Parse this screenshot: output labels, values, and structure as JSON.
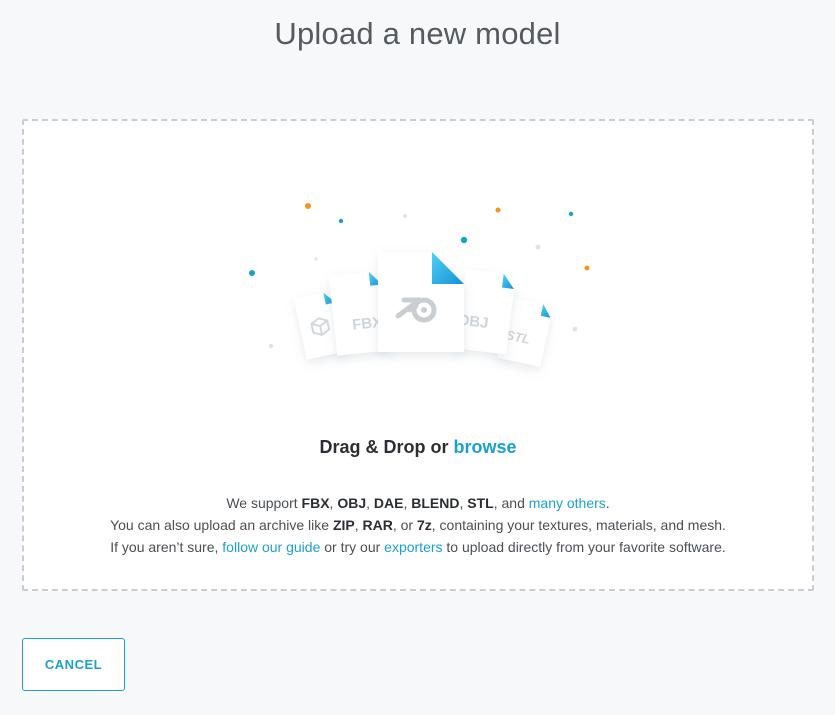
{
  "page": {
    "title": "Upload a new model"
  },
  "dropzone": {
    "drag_text": "Drag & Drop or ",
    "browse_label": "browse",
    "file_badges": {
      "fbx": "FBX",
      "obj": "OBJ",
      "stl": "STL"
    },
    "line1": {
      "prefix": "We support ",
      "fbx": "FBX",
      "sep1": ", ",
      "obj": "OBJ",
      "sep2": ", ",
      "dae": "DAE",
      "sep3": ", ",
      "blend": "BLEND",
      "sep4": ", ",
      "stl": "STL",
      "and": ", and ",
      "many_others_link": "many others",
      "end": "."
    },
    "line2": {
      "prefix": "You can also upload an archive like ",
      "zip": "ZIP",
      "sep1": ", ",
      "rar": "RAR",
      "or": ", or ",
      "sevenz": "7z",
      "suffix": ", containing your textures, materials, and mesh."
    },
    "line3": {
      "prefix": "If you aren’t sure, ",
      "guide_link": "follow our guide",
      "middle": " or try our ",
      "exporters_link": "exporters",
      "suffix": " to upload directly from your favorite software."
    }
  },
  "footer": {
    "cancel_label": "CANCEL"
  },
  "colors": {
    "accent": "#1ba1d1",
    "orange": "#f7941d",
    "border": "#c9cdd1"
  }
}
